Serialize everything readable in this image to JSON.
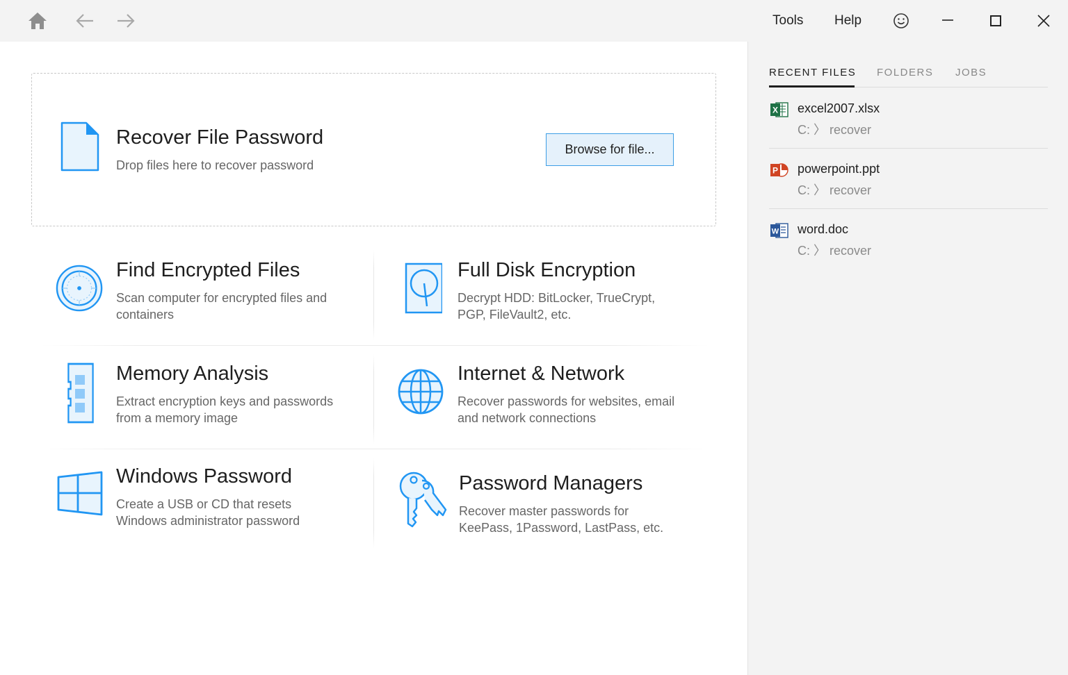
{
  "titlebar": {
    "nav": {
      "home_icon": "home-icon",
      "back_icon": "arrow-left-icon",
      "forward_icon": "arrow-right-icon"
    },
    "menu": {
      "tools": "Tools",
      "help": "Help"
    },
    "feedback_icon": "smiley-icon",
    "window": {
      "minimize_icon": "minimize-icon",
      "maximize_icon": "maximize-icon",
      "close_icon": "close-icon"
    }
  },
  "dropzone": {
    "title": "Recover File Password",
    "subtitle": "Drop files here to recover password",
    "browse_label": "Browse for file..."
  },
  "tiles": [
    {
      "title": "Find Encrypted Files",
      "desc": "Scan computer for encrypted files and containers",
      "icon": "disc-scan-icon"
    },
    {
      "title": "Full Disk Encryption",
      "desc": "Decrypt HDD: BitLocker, TrueCrypt, PGP, FileVault2, etc.",
      "icon": "hard-drive-icon"
    },
    {
      "title": "Memory Analysis",
      "desc": "Extract encryption keys and passwords from a memory image",
      "icon": "memory-chip-icon"
    },
    {
      "title": "Internet & Network",
      "desc": "Recover passwords for websites, email and network connections",
      "icon": "globe-icon"
    },
    {
      "title": "Windows Password",
      "desc": "Create a USB or CD that resets Windows administrator password",
      "icon": "windows-logo-icon"
    },
    {
      "title": "Password Managers",
      "desc": "Recover master passwords for KeePass, 1Password, LastPass, etc.",
      "icon": "keys-icon"
    }
  ],
  "sidebar": {
    "tabs": [
      {
        "label": "RECENT FILES",
        "active": true
      },
      {
        "label": "FOLDERS",
        "active": false
      },
      {
        "label": "JOBS",
        "active": false
      }
    ],
    "recent_files": [
      {
        "name": "excel2007.xlsx",
        "path": "C: 〉 recover",
        "icon": "excel-icon",
        "color": "#1e7145"
      },
      {
        "name": "powerpoint.ppt",
        "path": "C: 〉 recover",
        "icon": "powerpoint-icon",
        "color": "#d04423"
      },
      {
        "name": "word.doc",
        "path": "C: 〉 recover",
        "icon": "word-icon",
        "color": "#2b579a"
      }
    ]
  },
  "colors": {
    "accent": "#2196f3",
    "button_bg": "#e5f1fb",
    "button_border": "#3c9ee5"
  }
}
